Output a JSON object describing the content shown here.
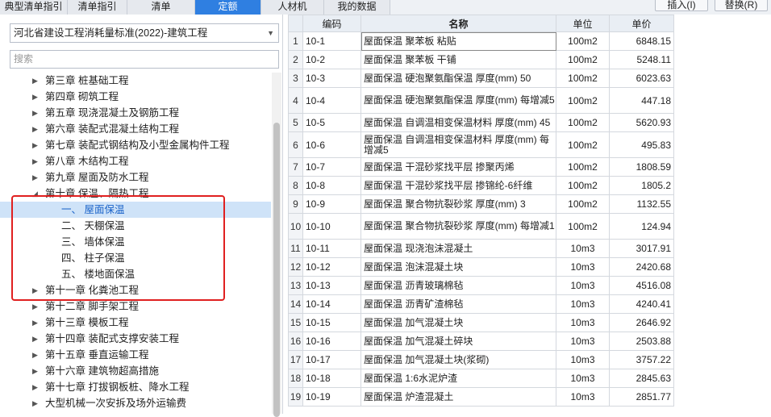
{
  "tabs": [
    {
      "label": "典型清单指引",
      "active": false
    },
    {
      "label": "清单指引",
      "active": false
    },
    {
      "label": "清单",
      "active": false
    },
    {
      "label": "定额",
      "active": true
    },
    {
      "label": "人材机",
      "active": false
    },
    {
      "label": "我的数据",
      "active": false
    }
  ],
  "toolbar": {
    "insert_label": "插入(I)",
    "replace_label": "替换(R)"
  },
  "left": {
    "library": "河北省建设工程消耗量标准(2022)-建筑工程",
    "search_placeholder": "搜索",
    "tree": [
      {
        "label": "第三章 桩基础工程",
        "level": 0,
        "expanded": false
      },
      {
        "label": "第四章 砌筑工程",
        "level": 0,
        "expanded": false
      },
      {
        "label": "第五章 现浇混凝土及钢筋工程",
        "level": 0,
        "expanded": false
      },
      {
        "label": "第六章 装配式混凝土结构工程",
        "level": 0,
        "expanded": false
      },
      {
        "label": "第七章 装配式钢结构及小型金属构件工程",
        "level": 0,
        "expanded": false
      },
      {
        "label": "第八章 木结构工程",
        "level": 0,
        "expanded": false
      },
      {
        "label": "第九章 屋面及防水工程",
        "level": 0,
        "expanded": false
      },
      {
        "label": "第十章 保温、隔热工程",
        "level": 0,
        "expanded": true
      },
      {
        "label": "一、 屋面保温",
        "level": 1,
        "selected": true
      },
      {
        "label": "二、 天棚保温",
        "level": 1
      },
      {
        "label": "三、 墙体保温",
        "level": 1
      },
      {
        "label": "四、 柱子保温",
        "level": 1
      },
      {
        "label": "五、 楼地面保温",
        "level": 1
      },
      {
        "label": "第十一章 化粪池工程",
        "level": 0,
        "expanded": false
      },
      {
        "label": "第十二章 脚手架工程",
        "level": 0,
        "expanded": false
      },
      {
        "label": "第十三章 模板工程",
        "level": 0,
        "expanded": false
      },
      {
        "label": "第十四章 装配式支撑安装工程",
        "level": 0,
        "expanded": false
      },
      {
        "label": "第十五章 垂直运输工程",
        "level": 0,
        "expanded": false
      },
      {
        "label": "第十六章 建筑物超高措施",
        "level": 0,
        "expanded": false
      },
      {
        "label": "第十七章 打拔钢板桩、降水工程",
        "level": 0,
        "expanded": false
      },
      {
        "label": "大型机械一次安拆及场外运输费",
        "level": 0,
        "expanded": false
      }
    ]
  },
  "table": {
    "headers": {
      "code": "编码",
      "name": "名称",
      "unit": "单位",
      "price": "单价"
    },
    "rows": [
      {
        "n": "1",
        "code": "10-1",
        "name": "屋面保温 聚苯板 粘贴",
        "unit": "100m2",
        "price": "6848.15"
      },
      {
        "n": "2",
        "code": "10-2",
        "name": "屋面保温 聚苯板 干铺",
        "unit": "100m2",
        "price": "5248.11"
      },
      {
        "n": "3",
        "code": "10-3",
        "name": "屋面保温 硬泡聚氨酯保温 厚度(mm) 50",
        "unit": "100m2",
        "price": "6023.63"
      },
      {
        "n": "4",
        "code": "10-4",
        "name": "屋面保温 硬泡聚氨酯保温 厚度(mm) 每增减5",
        "unit": "100m2",
        "price": "447.18"
      },
      {
        "n": "5",
        "code": "10-5",
        "name": "屋面保温 自调温相变保温材料 厚度(mm) 45",
        "unit": "100m2",
        "price": "5620.93"
      },
      {
        "n": "6",
        "code": "10-6",
        "name": "屋面保温 自调温相变保温材料 厚度(mm) 每增减5",
        "unit": "100m2",
        "price": "495.83"
      },
      {
        "n": "7",
        "code": "10-7",
        "name": "屋面保温 干混砂浆找平层 掺聚丙烯",
        "unit": "100m2",
        "price": "1808.59"
      },
      {
        "n": "8",
        "code": "10-8",
        "name": "屋面保温 干混砂浆找平层 掺锦纶-6纤维",
        "unit": "100m2",
        "price": "1805.2"
      },
      {
        "n": "9",
        "code": "10-9",
        "name": "屋面保温 聚合物抗裂砂浆 厚度(mm) 3",
        "unit": "100m2",
        "price": "1132.55"
      },
      {
        "n": "10",
        "code": "10-10",
        "name": "屋面保温 聚合物抗裂砂浆 厚度(mm) 每增减1",
        "unit": "100m2",
        "price": "124.94"
      },
      {
        "n": "11",
        "code": "10-11",
        "name": "屋面保温 现浇泡沫混凝土",
        "unit": "10m3",
        "price": "3017.91"
      },
      {
        "n": "12",
        "code": "10-12",
        "name": "屋面保温 泡沫混凝土块",
        "unit": "10m3",
        "price": "2420.68"
      },
      {
        "n": "13",
        "code": "10-13",
        "name": "屋面保温 沥青玻璃棉毡",
        "unit": "10m3",
        "price": "4516.08"
      },
      {
        "n": "14",
        "code": "10-14",
        "name": "屋面保温 沥青矿渣棉毡",
        "unit": "10m3",
        "price": "4240.41"
      },
      {
        "n": "15",
        "code": "10-15",
        "name": "屋面保温 加气混凝土块",
        "unit": "10m3",
        "price": "2646.92"
      },
      {
        "n": "16",
        "code": "10-16",
        "name": "屋面保温 加气混凝土碎块",
        "unit": "10m3",
        "price": "2503.88"
      },
      {
        "n": "17",
        "code": "10-17",
        "name": "屋面保温 加气混凝土块(浆砌)",
        "unit": "10m3",
        "price": "3757.22"
      },
      {
        "n": "18",
        "code": "10-18",
        "name": "屋面保温 1:6水泥炉渣",
        "unit": "10m3",
        "price": "2845.63"
      },
      {
        "n": "19",
        "code": "10-19",
        "name": "屋面保温 炉渣混凝土",
        "unit": "10m3",
        "price": "2851.77"
      }
    ]
  },
  "colors": {
    "accent": "#2f7fe1",
    "highlight_box": "#e02020",
    "selected_bg": "#cfe3f8"
  }
}
